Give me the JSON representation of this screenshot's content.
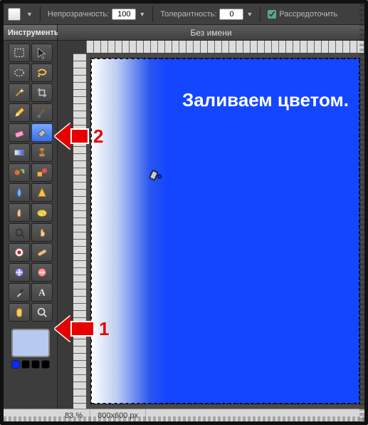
{
  "optbar": {
    "opacity_label": "Непрозрачность:",
    "opacity_value": "100",
    "tolerance_label": "Толерантность:",
    "tolerance_value": "0",
    "scatter_label": "Рассредоточить"
  },
  "tools_panel": {
    "title": "Инструменты",
    "items": [
      {
        "name": "rect-select",
        "glyph_svg": "rect-dashed"
      },
      {
        "name": "move",
        "glyph_svg": "cursor"
      },
      {
        "name": "ellipse-select",
        "glyph_svg": "ellipse-dashed"
      },
      {
        "name": "lasso",
        "glyph_svg": "lasso"
      },
      {
        "name": "magic-wand",
        "glyph_svg": "wand"
      },
      {
        "name": "crop",
        "glyph_svg": "crop"
      },
      {
        "name": "pencil",
        "glyph_svg": "pencil"
      },
      {
        "name": "brush",
        "glyph_svg": "brush"
      },
      {
        "name": "eraser",
        "glyph_svg": "eraser"
      },
      {
        "name": "paint-bucket",
        "glyph_svg": "bucket",
        "selected": true
      },
      {
        "name": "gradient",
        "glyph_svg": "gradient"
      },
      {
        "name": "clone-stamp",
        "glyph_svg": "stamp"
      },
      {
        "name": "color-replace",
        "glyph_svg": "replace"
      },
      {
        "name": "drawing",
        "glyph_svg": "shapes"
      },
      {
        "name": "blur",
        "glyph_svg": "drop"
      },
      {
        "name": "sharpen",
        "glyph_svg": "cone"
      },
      {
        "name": "smudge",
        "glyph_svg": "finger"
      },
      {
        "name": "sponge",
        "glyph_svg": "sponge"
      },
      {
        "name": "dodge",
        "glyph_svg": "dodge"
      },
      {
        "name": "burn",
        "glyph_svg": "burn"
      },
      {
        "name": "redeye",
        "glyph_svg": "redeye"
      },
      {
        "name": "spot-heal",
        "glyph_svg": "bandaid"
      },
      {
        "name": "bloat",
        "glyph_svg": "bloat"
      },
      {
        "name": "pinch",
        "glyph_svg": "pinch"
      },
      {
        "name": "eyedropper",
        "glyph_svg": "eyedrop"
      },
      {
        "name": "type",
        "glyph_svg": "type"
      },
      {
        "name": "hand",
        "glyph_svg": "hand"
      },
      {
        "name": "zoom",
        "glyph_svg": "zoom"
      }
    ],
    "foreground_color": "#b8c9f0",
    "mini_swatches": [
      "#0a2aff",
      "#000000",
      "#000000",
      "#000000"
    ]
  },
  "document": {
    "title": "Без имени",
    "overlay_text": "Заливаем цветом.",
    "fill_color": "#1446ff"
  },
  "status": {
    "zoom_value": "83",
    "zoom_unit": "%",
    "dimensions": "800x600 px"
  },
  "annotations": {
    "arrow1_label": "1",
    "arrow2_label": "2"
  }
}
